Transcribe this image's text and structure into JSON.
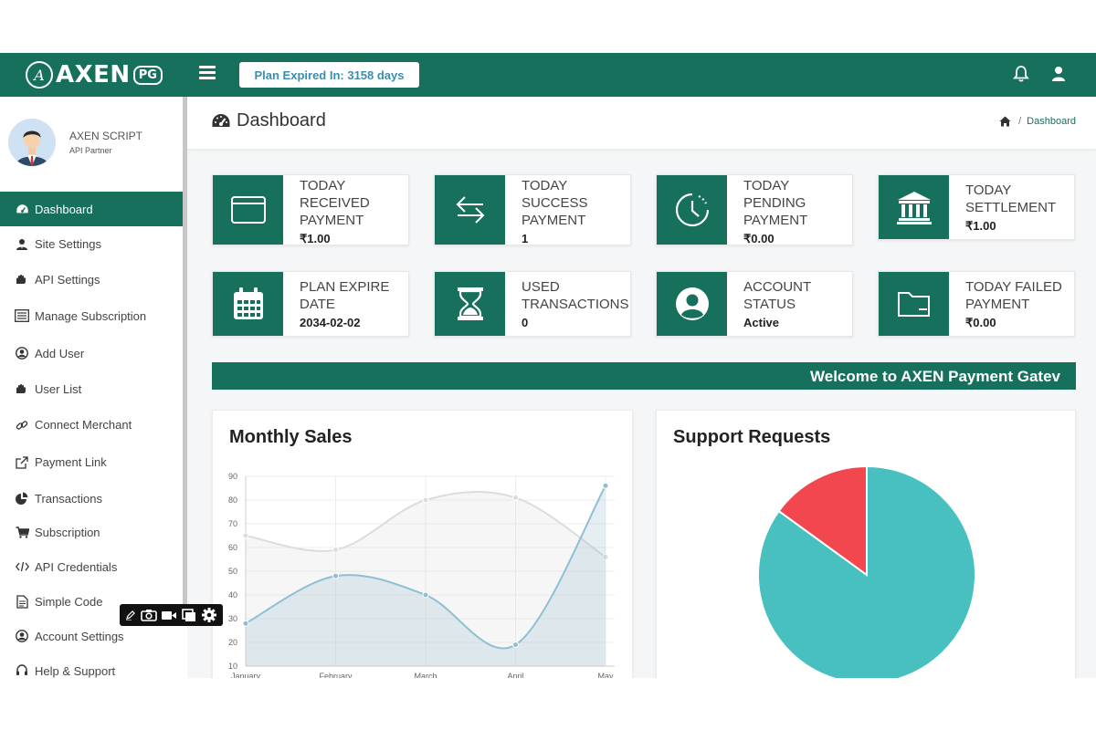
{
  "brand": {
    "logo_text": "AXEN",
    "badge": "PG"
  },
  "topbar": {
    "plan_label": "Plan Expired In: 3158 days"
  },
  "profile": {
    "name": "AXEN SCRIPT",
    "role": "API Partner"
  },
  "sidebar": {
    "items": [
      {
        "label": "Dashboard",
        "icon": "gauge-icon",
        "active": true
      },
      {
        "label": "Site Settings",
        "icon": "user-tie-icon"
      },
      {
        "label": "API Settings",
        "icon": "hand-icon"
      },
      {
        "label": "Manage Subscription",
        "icon": "list-icon"
      },
      {
        "label": "Add User",
        "icon": "user-circle-icon"
      },
      {
        "label": "User List",
        "icon": "hand-icon"
      },
      {
        "label": "Connect Merchant",
        "icon": "link-icon"
      },
      {
        "label": "Payment Link",
        "icon": "external-link-icon"
      },
      {
        "label": "Transactions",
        "icon": "pie-icon"
      },
      {
        "label": "Subscription",
        "icon": "cart-icon"
      },
      {
        "label": "API Credentials",
        "icon": "code-icon"
      },
      {
        "label": "Simple Code",
        "icon": "document-icon"
      },
      {
        "label": "Account Settings",
        "icon": "user-circle-icon"
      },
      {
        "label": "Help & Support",
        "icon": "headset-icon"
      }
    ]
  },
  "header": {
    "title": "Dashboard",
    "breadcrumb_current": "Dashboard",
    "breadcrumb_sep": "/"
  },
  "cards": [
    {
      "label": "TODAY RECEIVED PAYMENT",
      "value": "₹1.00",
      "icon": "wallet-icon"
    },
    {
      "label": "TODAY SUCCESS PAYMENT",
      "value": "1",
      "icon": "exchange-icon"
    },
    {
      "label": "TODAY PENDING PAYMENT",
      "value": "₹0.00",
      "icon": "clock-icon"
    },
    {
      "label": "TODAY SETTLEMENT",
      "value": "₹1.00",
      "icon": "bank-icon"
    },
    {
      "label": "PLAN EXPIRE DATE",
      "value": "2034-02-02",
      "icon": "calendar-icon"
    },
    {
      "label": "USED TRANSACTIONS",
      "value": "0",
      "icon": "hourglass-icon"
    },
    {
      "label": "ACCOUNT STATUS",
      "value": "Active",
      "icon": "user-circle-icon"
    },
    {
      "label": "TODAY FAILED PAYMENT",
      "value": "₹0.00",
      "icon": "folder-minus-icon"
    }
  ],
  "marquee": {
    "text": "Welcome to AXEN Payment Gatev"
  },
  "panels": {
    "monthly_sales_title": "Monthly Sales",
    "support_title": "Support Requests"
  },
  "colors": {
    "brand": "#17705b",
    "teal": "#47c0bf",
    "red": "#f2474f",
    "series1": "#dcdcdc",
    "series2": "#8fbfd3"
  },
  "chart_data": [
    {
      "type": "line",
      "title": "Monthly Sales",
      "categories": [
        "January",
        "February",
        "March",
        "April",
        "May"
      ],
      "ylim": [
        10,
        90
      ],
      "yticks": [
        10,
        20,
        30,
        40,
        50,
        60,
        70,
        80,
        90
      ],
      "series": [
        {
          "values": [
            65,
            59,
            80,
            81,
            56
          ]
        },
        {
          "values": [
            28,
            48,
            40,
            19,
            86
          ]
        }
      ],
      "grid": true
    },
    {
      "type": "pie",
      "title": "Support Requests",
      "values": [
        85,
        15
      ],
      "colors": [
        "#47c0bf",
        "#f2474f"
      ]
    }
  ]
}
